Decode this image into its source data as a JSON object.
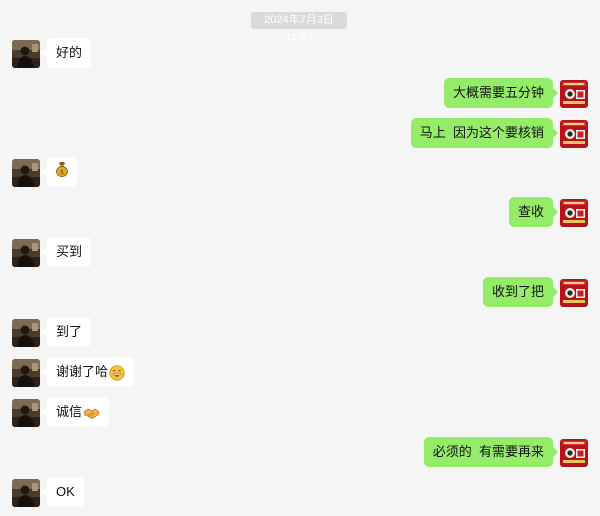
{
  "timestamp": "2024年7月3日 11:33",
  "messages": [
    {
      "side": "in",
      "text": "好的"
    },
    {
      "side": "out",
      "text": "大概需要五分钟"
    },
    {
      "side": "out",
      "text": "马上  因为这个要核销"
    },
    {
      "side": "in",
      "text": "",
      "emoji": "money-bag-emoji"
    },
    {
      "side": "out",
      "text": "查收"
    },
    {
      "side": "in",
      "text": "买到"
    },
    {
      "side": "out",
      "text": "收到了把"
    },
    {
      "side": "in",
      "text": "到了"
    },
    {
      "side": "in",
      "text": "谢谢了哈",
      "emoji": "grinning-face-emoji"
    },
    {
      "side": "in",
      "text": "诚信",
      "emoji": "handshake-emoji"
    },
    {
      "side": "out",
      "text": "必须的  有需要再来"
    },
    {
      "side": "in",
      "text": "OK"
    }
  ],
  "colors": {
    "background": "#f5f5f5",
    "incoming_bubble": "#ffffff",
    "outgoing_bubble": "#95ec69",
    "timestamp_bg": "#dadada",
    "outgoing_avatar": "#b3151b"
  },
  "avatars": {
    "incoming": "contact-avatar",
    "outgoing": "shop-avatar"
  }
}
